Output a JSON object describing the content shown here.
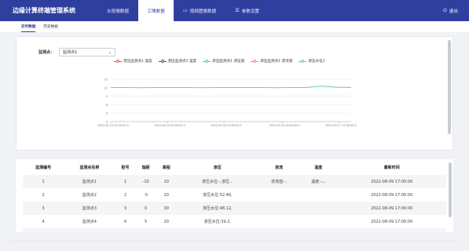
{
  "app": {
    "title": "边缘计算终端管理系统",
    "logout_icon": "power-icon",
    "logout_label": "退出"
  },
  "nav": [
    {
      "label": "水雨情数据",
      "icon": ""
    },
    {
      "label": "工情数据",
      "icon": ""
    },
    {
      "label": "视频图像数据",
      "icon": "▭"
    },
    {
      "label": "参数设置",
      "icon": "☰"
    }
  ],
  "subtabs": [
    "实时数据",
    "历史数据"
  ],
  "filter": {
    "label": "监测点：",
    "value": "监测点1"
  },
  "chart_data": {
    "type": "line",
    "series": [
      {
        "name": "渗压监测点1 温度",
        "color": "#e05a5a",
        "values": []
      },
      {
        "name": "渗压监测点2 温度",
        "color": "#555555",
        "values": []
      },
      {
        "name": "渗压监测点1 渗压值",
        "color": "#5ec7c0",
        "values": []
      },
      {
        "name": "渗压监测点1 渗流值",
        "color": "#f08a7a",
        "values": []
      },
      {
        "name": "渗压水位1",
        "color": "#6fc3b8",
        "values": []
      }
    ],
    "line": {
      "x": [
        "2022-09-12 00:00:00",
        "2022-09-12 12:00:00",
        "2022-09-13 00:00:00",
        "2022-09-13 12:00:00",
        "2022-09-14 00:00:00",
        "2022-09-14 12:00:00",
        "2022-09-15 00:00:00",
        "2022-09-15 12:00:00",
        "2022-09-16 00:00:00",
        "2022-09-16 12:00:00",
        "2022-09-17 00:00:00",
        "2022-09-17 12:00:00",
        "2022-09-18 00:00:00",
        "2022-09-18 12:00:00",
        "2022-09-19 00:00:00",
        "2022-09-19 12:00:00",
        "2022-09-20 00:00:00"
      ],
      "values": [
        12.1,
        12.1,
        12.0,
        12.1,
        12.1,
        12.1,
        12.0,
        12.1,
        12.1,
        12.1,
        12.1,
        12.0,
        12.1,
        12.1,
        12.6,
        12.2,
        12.1
      ]
    },
    "x_tick_labels": [
      "2022-09-12 00:00:00.0",
      "2022-09-14 04:00:00.0",
      "2022-09-16 10:00:00.0",
      "2022-09-18 10:00:00.0",
      "2022-09-17 12:00:00.0"
    ],
    "y_ticks": [
      0,
      3,
      6,
      9,
      12,
      15
    ],
    "ylim": [
      0,
      15
    ],
    "grid": true
  },
  "table": {
    "headers": [
      "监测编号",
      "监测点名称",
      "桩号",
      "轴距",
      "高程",
      "渗压",
      "渗流",
      "温度",
      "最新时间"
    ],
    "rows": [
      [
        "1",
        "监测点1",
        "1",
        "-10",
        "10",
        "渗压水位:-,渗压...",
        "渗流值:-,",
        "温度:-,-,",
        "2022-08-09 17:00:00"
      ],
      [
        "2",
        "监测点2",
        "2",
        "-5",
        "20",
        "渗压水位:52.46,",
        "",
        "",
        "2022-08-09 17:00:00"
      ],
      [
        "3",
        "监测点3",
        "3",
        "0",
        "30",
        "渗压水位:48.12,",
        "",
        "",
        "2022-08-09 17:00:00"
      ],
      [
        "4",
        "监测点4",
        "4",
        "5",
        "20",
        "渗压水位:39.2,",
        "",
        "",
        "2022-08-09 17:00:00"
      ],
      [
        "5",
        "监测点5",
        "5",
        "10",
        "10",
        "渗压水位:33.76,",
        "",
        "",
        "2022-08-09 17:00:00"
      ]
    ]
  }
}
